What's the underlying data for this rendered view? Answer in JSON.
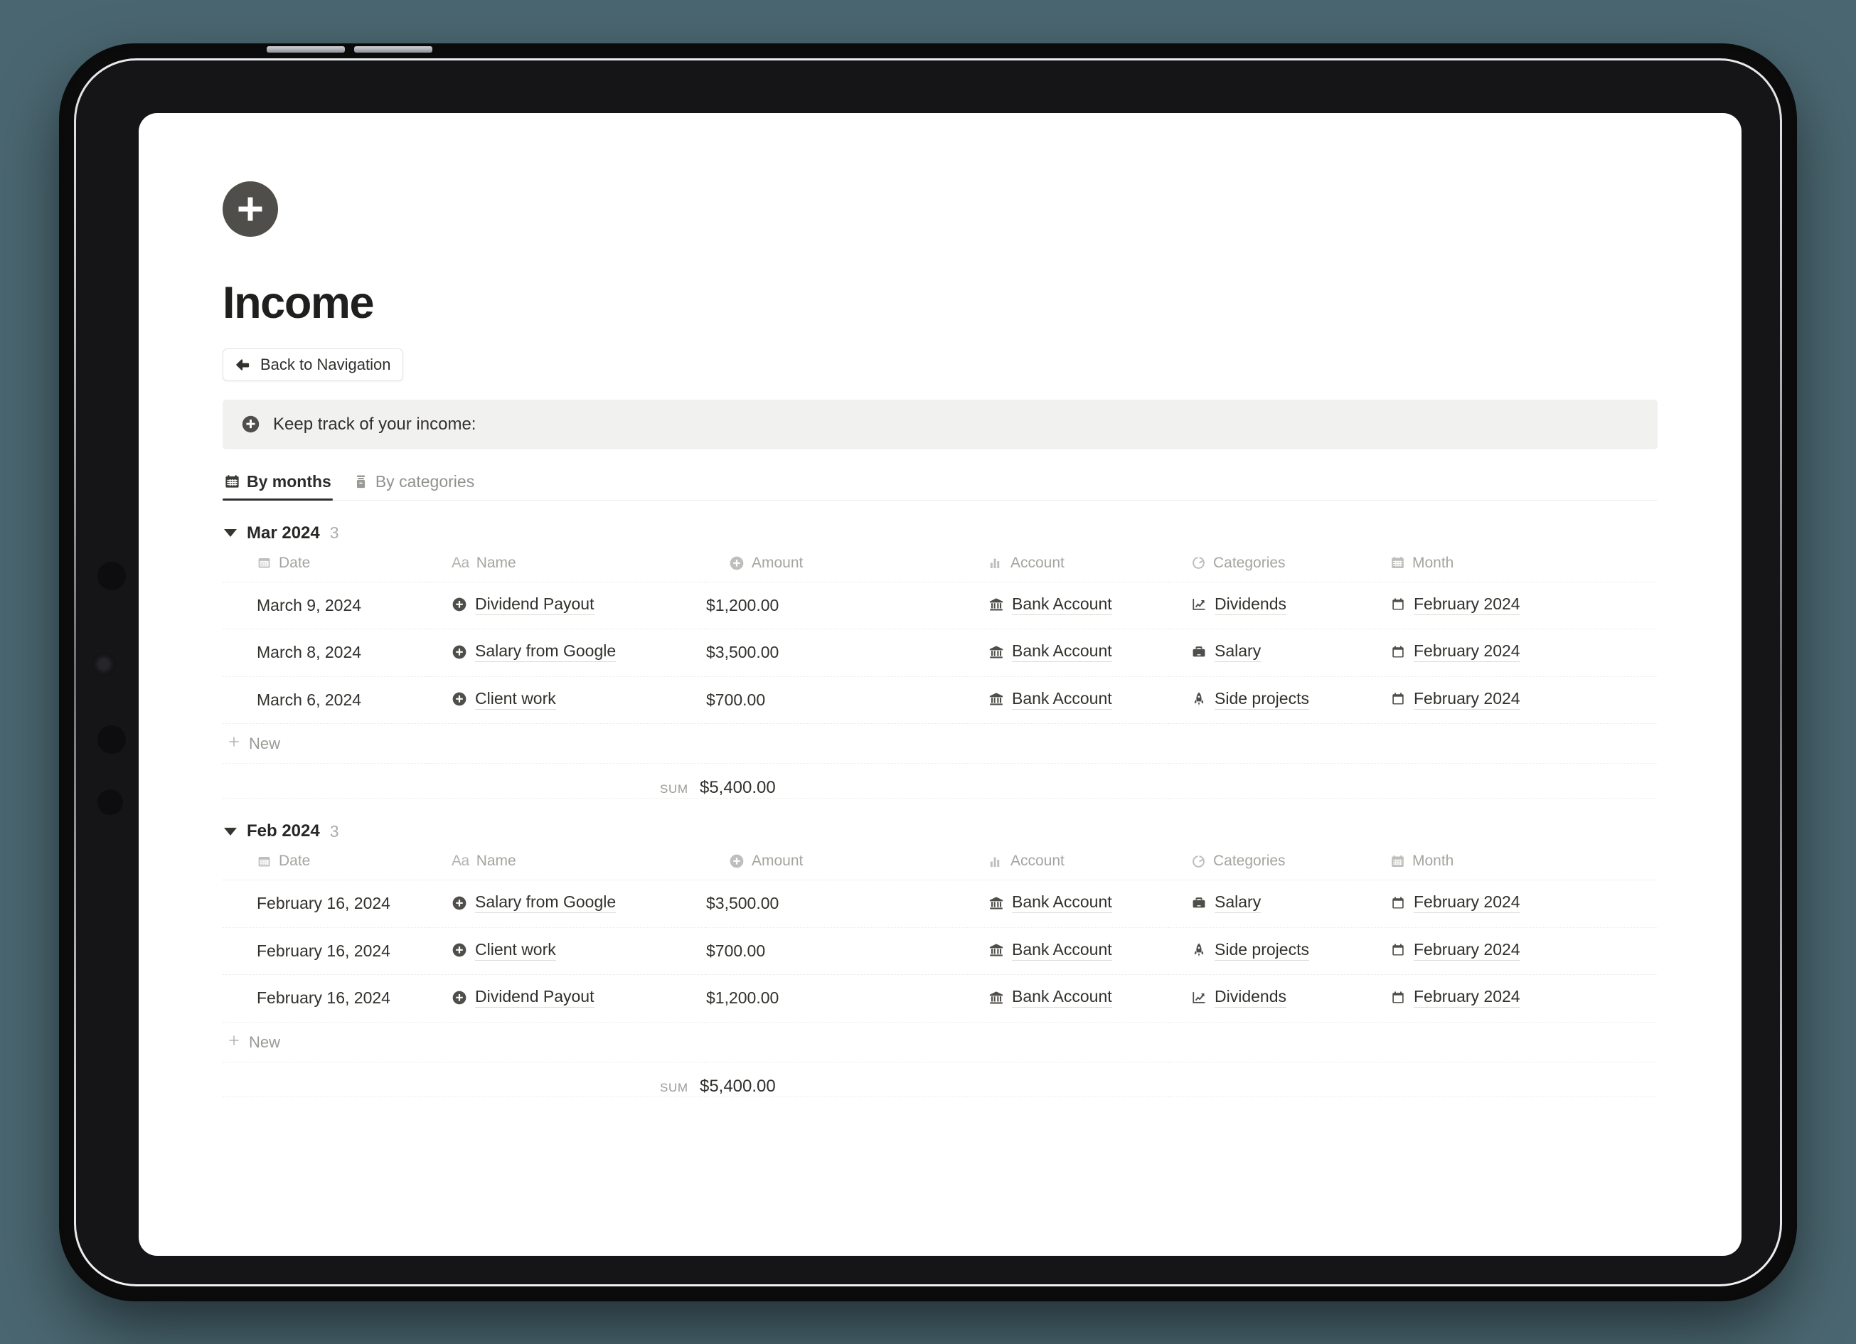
{
  "page": {
    "icon_name": "plus-circle-icon",
    "title": "Income",
    "back_button_label": "Back to Navigation",
    "callout_text": "Keep track of your income:",
    "callout_icon": "plus-circle-icon"
  },
  "tabs": [
    {
      "label": "By months",
      "icon": "calendar-grid-icon",
      "active": true
    },
    {
      "label": "By categories",
      "icon": "archive-box-icon",
      "active": false
    }
  ],
  "columns": [
    {
      "label": "Date",
      "icon": "calendar-icon"
    },
    {
      "label": "Name",
      "icon": "aa-text-icon"
    },
    {
      "label": "Amount",
      "icon": "plus-circle-icon"
    },
    {
      "label": "Account",
      "icon": "bar-chart-icon"
    },
    {
      "label": "Categories",
      "icon": "pie-chart-icon"
    },
    {
      "label": "Month",
      "icon": "calendar-grid-icon"
    }
  ],
  "new_row_label": "New",
  "sum_label": "SUM",
  "groups": [
    {
      "name": "Mar 2024",
      "count": "3",
      "sum": "$5,400.00",
      "rows": [
        {
          "date": "March 9, 2024",
          "name": "Dividend Payout",
          "name_icon": "plus-circle-icon",
          "amount": "$1,200.00",
          "account": "Bank Account",
          "account_icon": "bank-icon",
          "category": "Dividends",
          "category_icon": "chart-line-icon",
          "month": "February 2024",
          "month_icon": "calendar-icon"
        },
        {
          "date": "March 8, 2024",
          "name": "Salary from Google",
          "name_icon": "plus-circle-icon",
          "amount": "$3,500.00",
          "account": "Bank Account",
          "account_icon": "bank-icon",
          "category": "Salary",
          "category_icon": "briefcase-icon",
          "month": "February 2024",
          "month_icon": "calendar-icon"
        },
        {
          "date": "March 6, 2024",
          "name": "Client work",
          "name_icon": "plus-circle-icon",
          "amount": "$700.00",
          "account": "Bank Account",
          "account_icon": "bank-icon",
          "category": "Side projects",
          "category_icon": "rocket-icon",
          "month": "February 2024",
          "month_icon": "calendar-icon"
        }
      ]
    },
    {
      "name": "Feb 2024",
      "count": "3",
      "sum": "$5,400.00",
      "rows": [
        {
          "date": "February 16, 2024",
          "name": "Salary from Google",
          "name_icon": "plus-circle-icon",
          "amount": "$3,500.00",
          "account": "Bank Account",
          "account_icon": "bank-icon",
          "category": "Salary",
          "category_icon": "briefcase-icon",
          "month": "February 2024",
          "month_icon": "calendar-icon"
        },
        {
          "date": "February 16, 2024",
          "name": "Client work",
          "name_icon": "plus-circle-icon",
          "amount": "$700.00",
          "account": "Bank Account",
          "account_icon": "bank-icon",
          "category": "Side projects",
          "category_icon": "rocket-icon",
          "month": "February 2024",
          "month_icon": "calendar-icon"
        },
        {
          "date": "February 16, 2024",
          "name": "Dividend Payout",
          "name_icon": "plus-circle-icon",
          "amount": "$1,200.00",
          "account": "Bank Account",
          "account_icon": "bank-icon",
          "category": "Dividends",
          "category_icon": "chart-line-icon",
          "month": "February 2024",
          "month_icon": "calendar-icon"
        }
      ]
    }
  ],
  "colors": {
    "background": "#4a6670",
    "device": "#0b0b0c",
    "callout_bg": "#f1f1ef",
    "text": "#32302c",
    "muted": "#a5a49f",
    "accent": "#4f4e4a"
  }
}
